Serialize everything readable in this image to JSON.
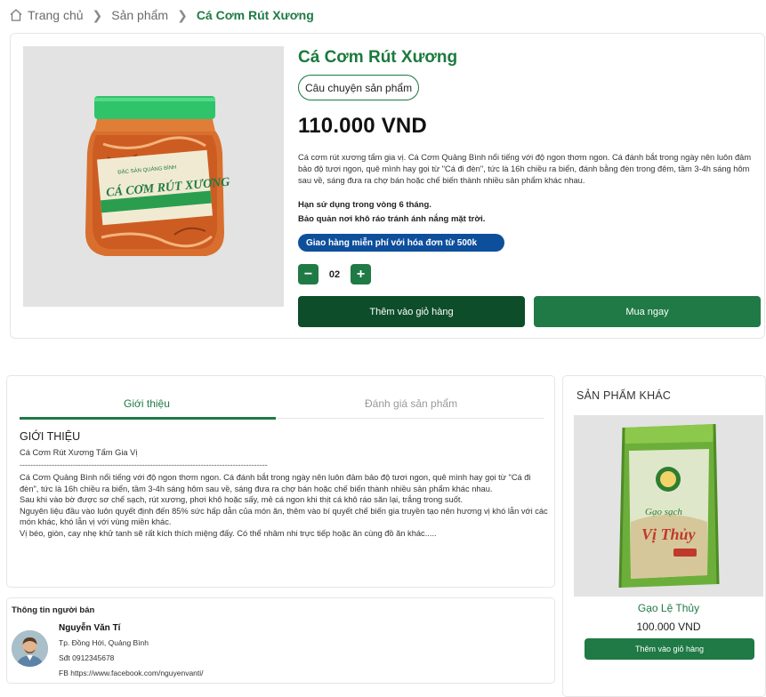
{
  "breadcrumb": {
    "home": "Trang chủ",
    "category": "Sản phẩm",
    "current": "Cá Cơm Rút Xương",
    "icons": {
      "home": "home-icon",
      "separator": "chevron-right-icon"
    }
  },
  "product": {
    "title": "Cá Cơm Rút Xương",
    "story_button": "Câu chuyện sản phẩm",
    "price": "110.000 VND",
    "description": "Cá cơm rút xương tẩm gia vị. Cá Cơm Quảng Bình nổi tiếng với độ ngon thơm ngon. Cá đánh bắt trong ngày nên luôn đảm bảo độ tươi ngon, quê mình hay gọi từ \"Cá đi đèn\", tức là 16h chiều ra biển, đánh bằng đèn trong đêm, tầm 3-4h sáng hôm sau về, sáng đưa ra chợ bán hoặc chế biến thành nhiều sản phẩm khác nhau.",
    "shelf_life": "Hạn sử dụng trong vòng 6 tháng.",
    "storage": "Bảo quản nơi khô ráo tránh ánh nắng mặt trời.",
    "shipping_badge": "Giao hàng miễn phí với hóa đơn từ 500k",
    "quantity": "02",
    "add_to_cart": "Thêm vào giỏ hàng",
    "buy_now": "Mua ngay",
    "image": {
      "label_lines": [
        "ĐẶC SẢN QUẢNG BÌNH",
        "CÁ CƠM RÚT XƯƠNG"
      ]
    }
  },
  "tabs": {
    "items": [
      "Giới thiệu",
      "Đánh giá sản phẩm"
    ],
    "active": 0,
    "intro": {
      "heading": "GIỚI THIỆU",
      "subtitle": "Cá Cơm Rút Xương Tẩm Gia Vị",
      "divider": "---------------------------------------------------------------------------------------------",
      "paragraphs": [
        "Cá Cơm Quảng Bình nổi tiếng với độ ngon thơm ngon. Cá đánh bắt trong ngày nên luôn đảm bảo độ tươi ngon, quê mình hay gọi từ \"Cá đi đèn\", tức là 16h chiều ra biển, tầm 3-4h sáng hôm sau về, sáng đưa ra chợ bán hoặc chế biến thành nhiều sản phẩm khác nhau.",
        "Sau khi vào bờ được sơ chế sạch, rút xương, phơi khô hoặc sấy, mẻ cá ngon khi thịt cá khô ráo săn lại, trắng trong suốt.",
        "Nguyên liệu đầu vào luôn quyết định đến 85% sức hấp dẫn của món ăn, thêm vào bí quyết chế biến gia truyền tạo nên hương vị khó lẫn với các món khác, khó lẫn vị với vùng miền khác.",
        "Vị béo, giòn, cay nhẹ khử tanh sẽ rất kích thích miệng đấy. Có thể nhâm nhi trực tiếp hoặc ăn cùng đồ ăn khác....."
      ]
    }
  },
  "seller": {
    "heading": "Thông tin người bán",
    "name": "Nguyễn Văn Tí",
    "address": "Tp. Đồng Hới, Quảng Bình",
    "phone": "Sđt 0912345678",
    "facebook": "FB https://www.facebook.com/nguyenvanti/"
  },
  "other_products": {
    "heading": "SẢN PHẨM KHÁC",
    "items": [
      {
        "name": "Gạo Lệ Thủy",
        "price": "100.000 VND",
        "add_to_cart": "Thêm vào giỏ hàng",
        "bag_text": [
          "Gạo sạch",
          "Vị Thủy"
        ]
      }
    ]
  },
  "colors": {
    "primary_green": "#1f7a45",
    "dark_green": "#0d4d2a",
    "badge_blue": "#0e4f9c"
  }
}
